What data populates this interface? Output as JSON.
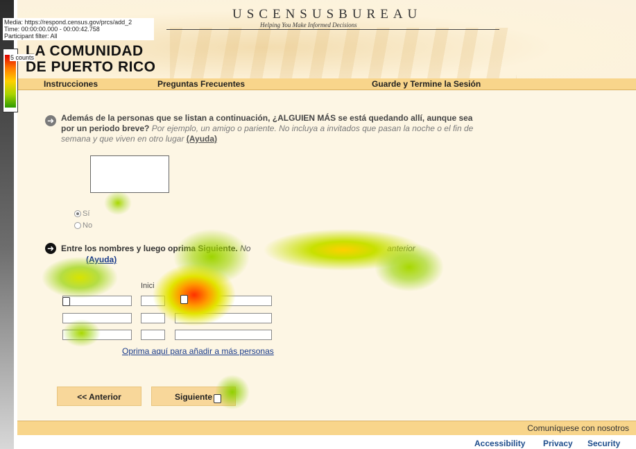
{
  "overlay": {
    "media_line": "Media: https://respond.census.gov/prcs/add_2",
    "time_line": "Time: 00:00:00.000 - 00:00:42.758",
    "filter_line": "Participant filter: All",
    "legend_label": "5 counts"
  },
  "header": {
    "agency": "USCENSUSBUREAU",
    "tagline": "Helping You Make Informed Decisions",
    "survey_line1": "LA COMUNIDAD",
    "survey_line2": "DE PUERTO RICO"
  },
  "nav": {
    "instructions": "Instrucciones",
    "faq": "Preguntas Frecuentes",
    "save_exit": "Guarde y Termine la Sesión"
  },
  "question1": {
    "text": "Además de la personas que se listan a continuación, ¿ALGUIEN MÁS se está quedando allí, aunque sea por un periodo breve?",
    "hint": "Por ejemplo, un amigo o pariente. No incluya a invitados que pasan la noche o el fin de semana y que viven en otro lugar",
    "help_link": "(Ayuda)",
    "option_yes": "Sí",
    "option_no": "No"
  },
  "instruction2": {
    "text": "Entre los nombres y luego oprima Siguiente.",
    "italic_start": "No",
    "italic_end": "anterior",
    "help_link": "(Ayuda)"
  },
  "name_table": {
    "col_initial": "Inici"
  },
  "add_more_link": "Oprima aquí para añadir a más personas",
  "buttons": {
    "previous": "<< Anterior",
    "next": "Siguiente"
  },
  "footer": {
    "contact": "Comuníquese con nosotros"
  },
  "bottom_links": {
    "accessibility": "Accessibility",
    "privacy": "Privacy",
    "security": "Security"
  },
  "colors": {
    "nav_bg": "#f8d58b",
    "content_bg": "#fdf6e4",
    "button_bg": "#f8d79a",
    "link": "#1a3b8a"
  }
}
